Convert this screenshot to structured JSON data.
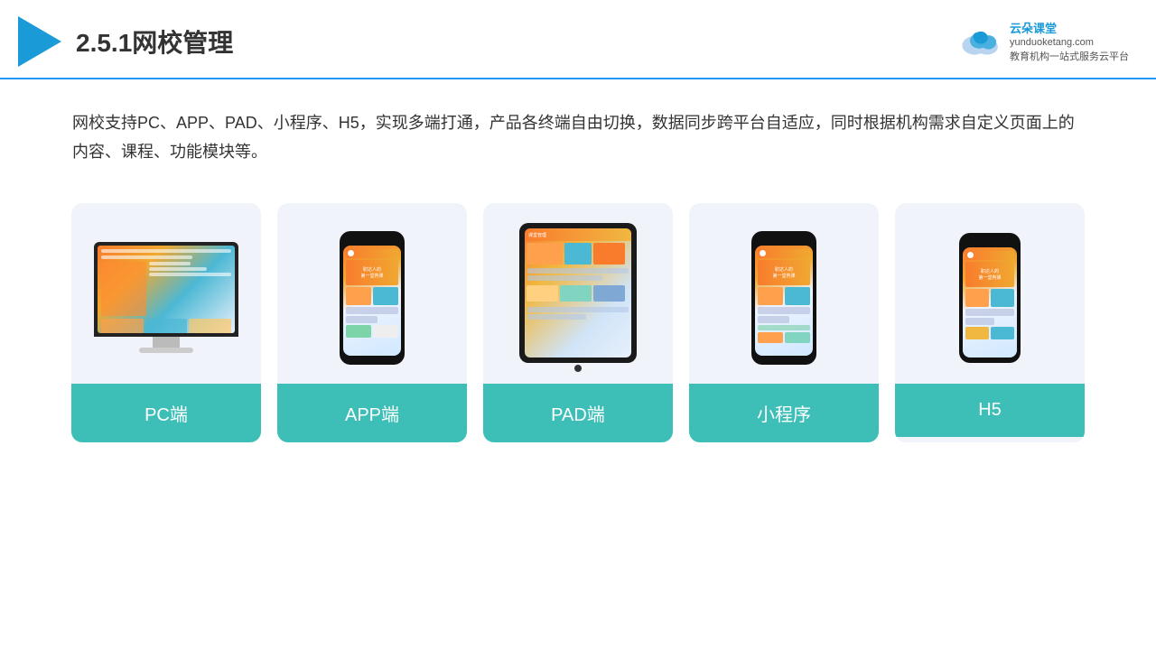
{
  "header": {
    "title": "2.5.1网校管理",
    "brand_name": "云朵课堂",
    "brand_url": "yunduoketang.com",
    "brand_tagline": "教育机构一站\n式服务云平台"
  },
  "description": {
    "text": "网校支持PC、APP、PAD、小程序、H5，实现多端打通，产品各终端自由切换，数据同步跨平台自适应，同时根据机构需求自定义页面上的内容、课程、功能模块等。"
  },
  "cards": [
    {
      "id": "pc",
      "label": "PC端"
    },
    {
      "id": "app",
      "label": "APP端"
    },
    {
      "id": "pad",
      "label": "PAD端"
    },
    {
      "id": "miniapp",
      "label": "小程序"
    },
    {
      "id": "h5",
      "label": "H5"
    }
  ]
}
